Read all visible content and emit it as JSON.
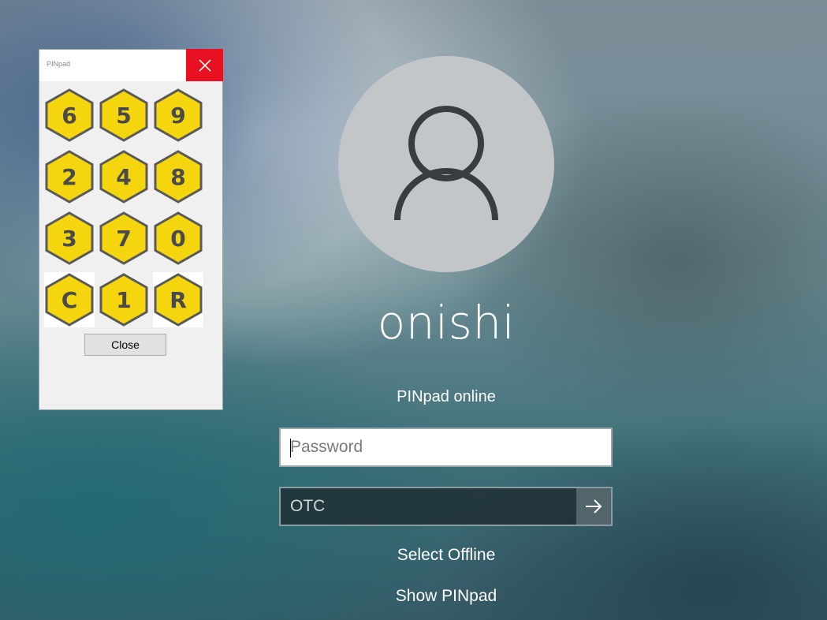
{
  "pinpad": {
    "window_title": "PINpad",
    "keys": [
      "6",
      "5",
      "9",
      "2",
      "4",
      "8",
      "3",
      "7",
      "0",
      "C",
      "1",
      "R"
    ],
    "close_label": "Close",
    "close_icon": "close-icon",
    "key_color": "#f5d50e",
    "close_color": "#e81123"
  },
  "login": {
    "username": "onishi",
    "status": "PINpad online",
    "password_placeholder": "Password",
    "otc_placeholder": "OTC",
    "submit_icon": "arrow-right-icon",
    "select_offline": "Select Offline",
    "show_pinpad": "Show PINpad"
  }
}
